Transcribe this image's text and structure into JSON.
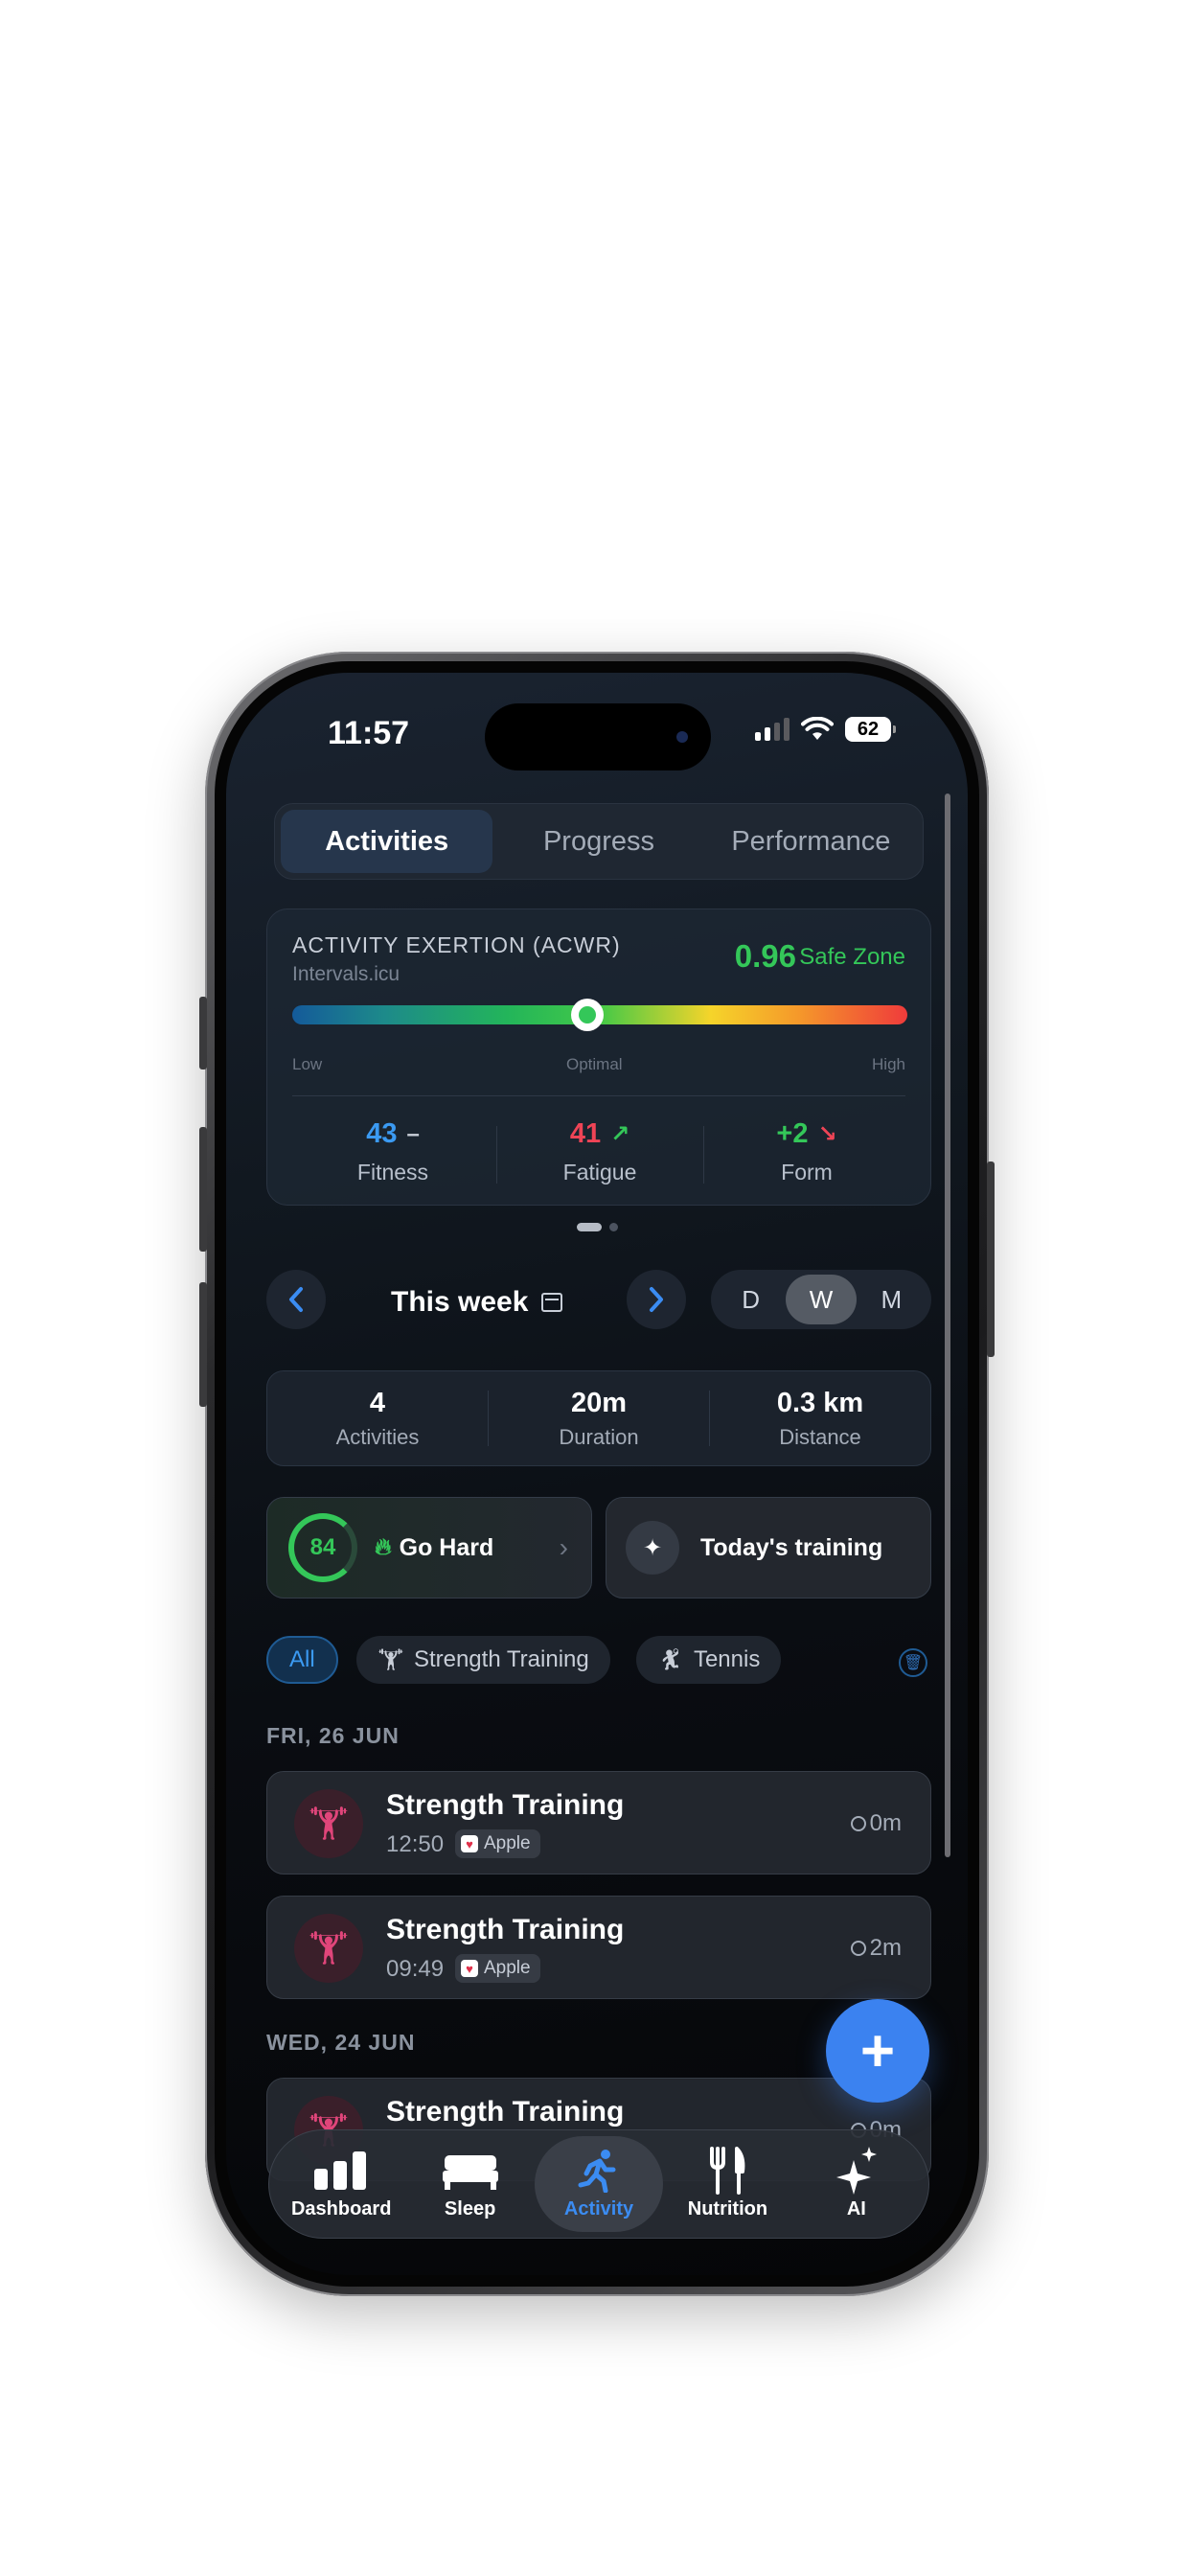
{
  "status_bar": {
    "time": "11:57",
    "battery": "62"
  },
  "segments": [
    {
      "label": "Activities",
      "active": true
    },
    {
      "label": "Progress",
      "active": false
    },
    {
      "label": "Performance",
      "active": false
    }
  ],
  "acwr": {
    "title": "ACTIVITY EXERTION (ACWR)",
    "source": "Intervals.icu",
    "value": "0.96",
    "zone": "Safe Zone",
    "marker_position": 0.48,
    "scale_low": "Low",
    "scale_mid": "Optimal",
    "scale_high": "High",
    "metrics": [
      {
        "value": "43",
        "trend": "–",
        "name": "Fitness",
        "color": "#3b9af2"
      },
      {
        "value": "41",
        "trend": "↗",
        "name": "Fatigue",
        "color": "#ef4456"
      },
      {
        "value": "+2",
        "trend": "↘",
        "name": "Form",
        "color": "#34c759",
        "trend_color": "#ef4456"
      }
    ]
  },
  "pager": {
    "pages": 2,
    "current": 1
  },
  "period": {
    "prev_icon": "chevron-left-icon",
    "label": "This week",
    "next_icon": "chevron-right-icon",
    "options": [
      "D",
      "W",
      "M"
    ],
    "selected": "W"
  },
  "stats": [
    {
      "value": "4",
      "label": "Activities"
    },
    {
      "value": "20m",
      "label": "Duration"
    },
    {
      "value": "0.3 km",
      "label": "Distance"
    }
  ],
  "readiness": {
    "score": "84",
    "label": "Go Hard"
  },
  "training": {
    "label": "Today's training"
  },
  "filters": [
    {
      "label": "All",
      "active": true
    },
    {
      "label": "Strength Training",
      "active": false
    },
    {
      "label": "Tennis",
      "active": false
    }
  ],
  "groups": [
    {
      "date": "FRI, 26 JUN",
      "activities": [
        {
          "title": "Strength Training",
          "time": "12:50",
          "source": "Apple",
          "duration": "0m"
        },
        {
          "title": "Strength Training",
          "time": "09:49",
          "source": "Apple",
          "duration": "2m"
        }
      ]
    },
    {
      "date": "WED, 24 JUN",
      "activities": [
        {
          "title": "Strength Training",
          "time": "",
          "source": "",
          "duration": "0m"
        }
      ]
    }
  ],
  "fab": {
    "icon": "plus-icon"
  },
  "tabbar": [
    {
      "label": "Dashboard",
      "icon": "bar-chart-icon",
      "active": false
    },
    {
      "label": "Sleep",
      "icon": "bed-icon",
      "active": false
    },
    {
      "label": "Activity",
      "icon": "running-icon",
      "active": true
    },
    {
      "label": "Nutrition",
      "icon": "fork-knife-icon",
      "active": false
    },
    {
      "label": "AI",
      "icon": "sparkles-icon",
      "active": false
    }
  ]
}
